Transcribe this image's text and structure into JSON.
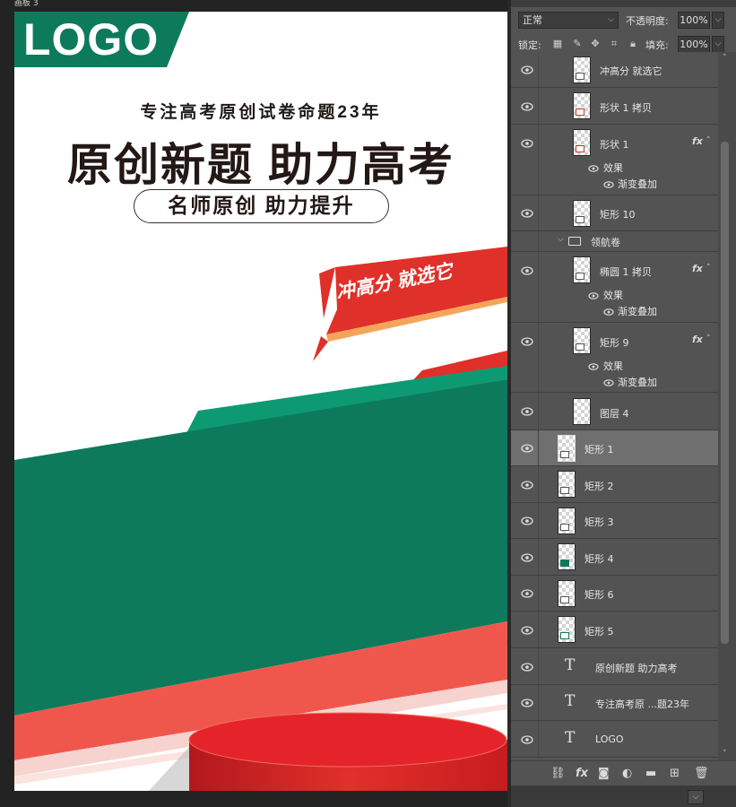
{
  "document": {
    "tab_title": "画板 3"
  },
  "poster": {
    "logo": "LOGO",
    "subtitle": "专注高考原创试卷命题23年",
    "main_title": "原创新题 助力高考",
    "pill_text": "名师原创 助力提升",
    "banner_text": "冲高分 就选它",
    "colors": {
      "green": "#0e7a5c",
      "red": "#e0302a",
      "coral": "#f26b5f",
      "pink": "#f8c4be"
    }
  },
  "layers_panel": {
    "blend_mode": "正常",
    "opacity_label": "不透明度:",
    "opacity_value": "100%",
    "lock_label": "锁定:",
    "fill_label": "填充:",
    "fill_value": "100%",
    "effects_label": "效果",
    "gradient_overlay_label": "渐变叠加",
    "layers": [
      {
        "name": "冲高分 就选它",
        "kind": "smart"
      },
      {
        "name": "形状 1 拷贝",
        "kind": "shape"
      },
      {
        "name": "形状 1",
        "kind": "shape",
        "fx": "fx"
      },
      {
        "name": "矩形 10",
        "kind": "shape"
      },
      {
        "name": "领航卷",
        "kind": "group"
      },
      {
        "name": "椭圆 1 拷贝",
        "kind": "shape",
        "fx": "fx"
      },
      {
        "name": "矩形 9",
        "kind": "shape",
        "fx": "fx"
      },
      {
        "name": "图层 4",
        "kind": "pixel"
      },
      {
        "name": "矩形 1",
        "kind": "shape",
        "selected": true
      },
      {
        "name": "矩形 2",
        "kind": "shape"
      },
      {
        "name": "矩形 3",
        "kind": "shape"
      },
      {
        "name": "矩形 4",
        "kind": "shape"
      },
      {
        "name": "矩形 6",
        "kind": "shape"
      },
      {
        "name": "矩形 5",
        "kind": "shape"
      },
      {
        "name": "原创新题 助力高考",
        "kind": "text",
        "icon": "T"
      },
      {
        "name": "专注高考原 ...题23年",
        "kind": "text",
        "icon": "T"
      },
      {
        "name": "LOGO",
        "kind": "text",
        "icon": "T"
      }
    ],
    "footer_icons": [
      "link-icon",
      "fx-icon",
      "mask-icon",
      "adjustment-icon",
      "folder-icon",
      "new-layer-icon",
      "trash-icon"
    ],
    "footer_fx": "fx"
  }
}
